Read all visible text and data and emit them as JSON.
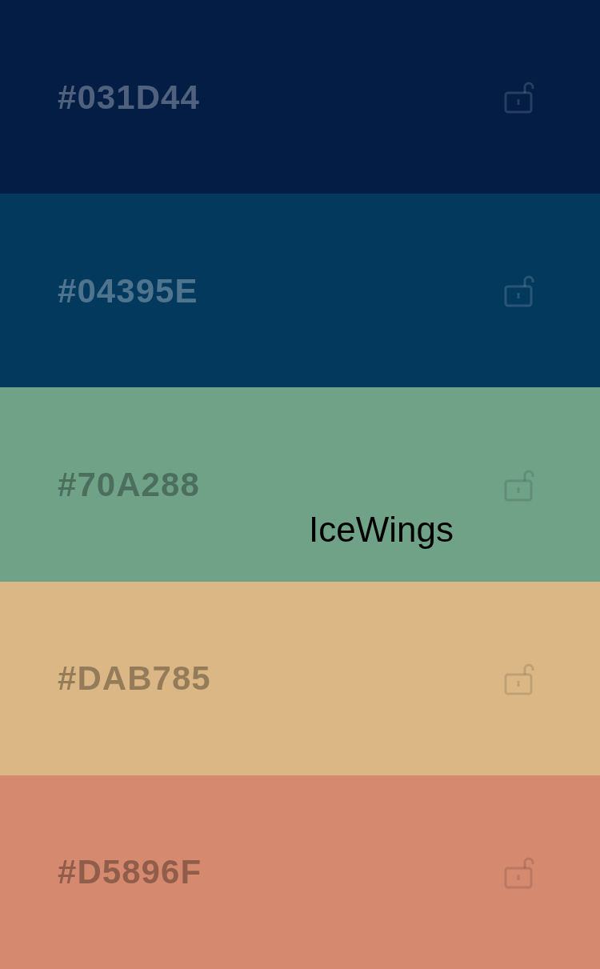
{
  "palette_name": "IceWings",
  "swatches": [
    {
      "hex": "#031D44",
      "color": "#031d44",
      "locked": false
    },
    {
      "hex": "#04395E",
      "color": "#04395e",
      "locked": false
    },
    {
      "hex": "#70A288",
      "color": "#70a288",
      "locked": false
    },
    {
      "hex": "#DAB785",
      "color": "#dab785",
      "locked": false
    },
    {
      "hex": "#D5896F",
      "color": "#d5896f",
      "locked": false
    }
  ]
}
